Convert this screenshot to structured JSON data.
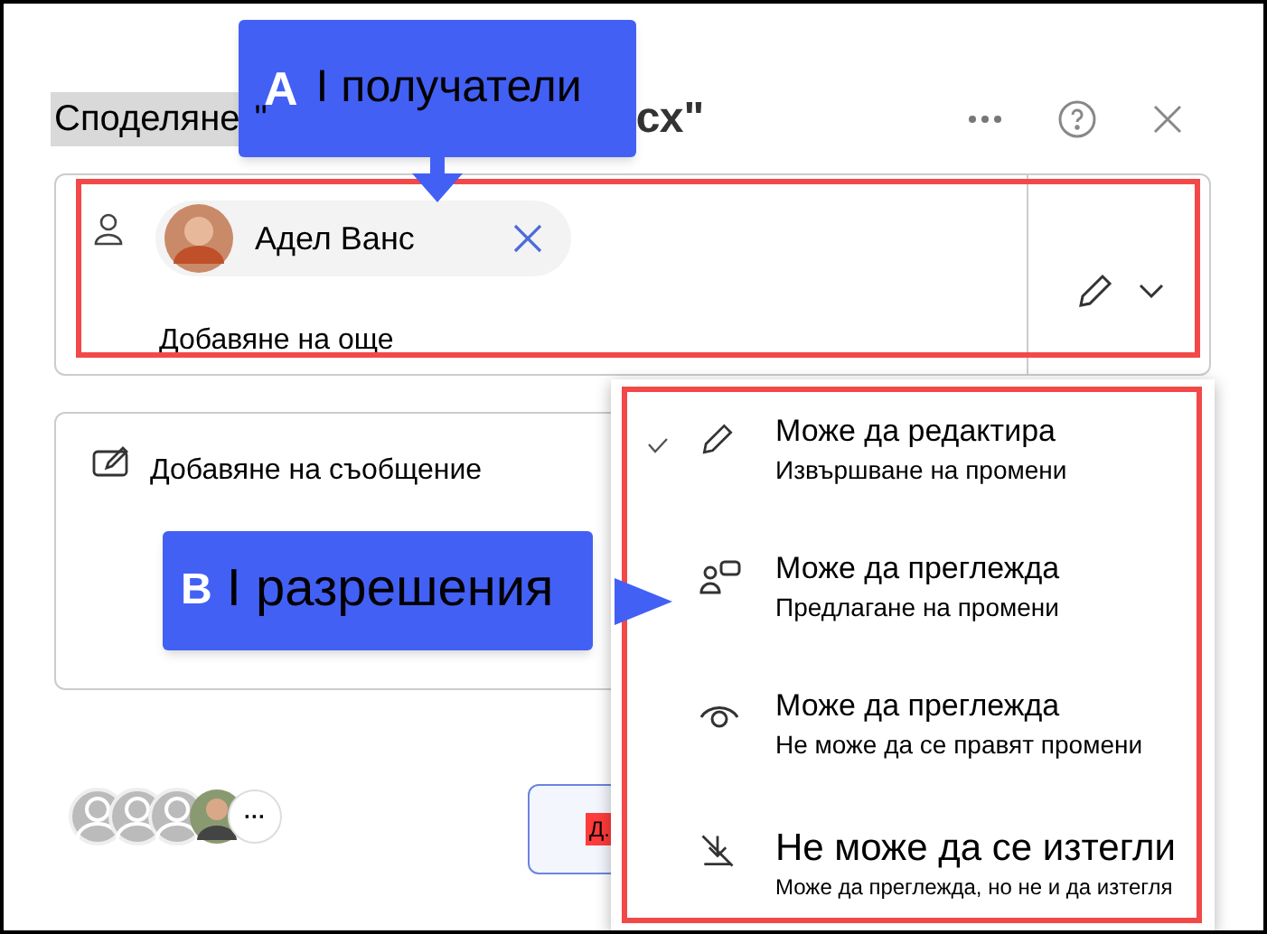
{
  "title_parts": [
    "Споделяне",
    "\"",
    "сх\""
  ],
  "recipients": {
    "chips": [
      {
        "name": "Адел Ванс"
      }
    ],
    "placeholder": "Добавяне на още"
  },
  "message": {
    "placeholder": "Добавяне на съобщение"
  },
  "permissions": [
    {
      "kind": "edit",
      "title": "Може да редактира",
      "subtitle": "Извършване на промени",
      "selected": true
    },
    {
      "kind": "review",
      "title": "Може да преглежда",
      "subtitle": "Предлагане на промени",
      "selected": false
    },
    {
      "kind": "view",
      "title": "Може да преглежда",
      "subtitle": "Не може да се правят промени",
      "selected": false
    },
    {
      "kind": "nodownload",
      "title": "Не може да се изтегли",
      "subtitle": "Може да преглежда, но не и да изтегля",
      "selected": false
    }
  ],
  "callouts": [
    {
      "letter": "А",
      "text": "I получатели"
    },
    {
      "letter": "B",
      "text": "I разрешения"
    }
  ],
  "footer": {
    "more": "···",
    "button_tag": "Д."
  }
}
